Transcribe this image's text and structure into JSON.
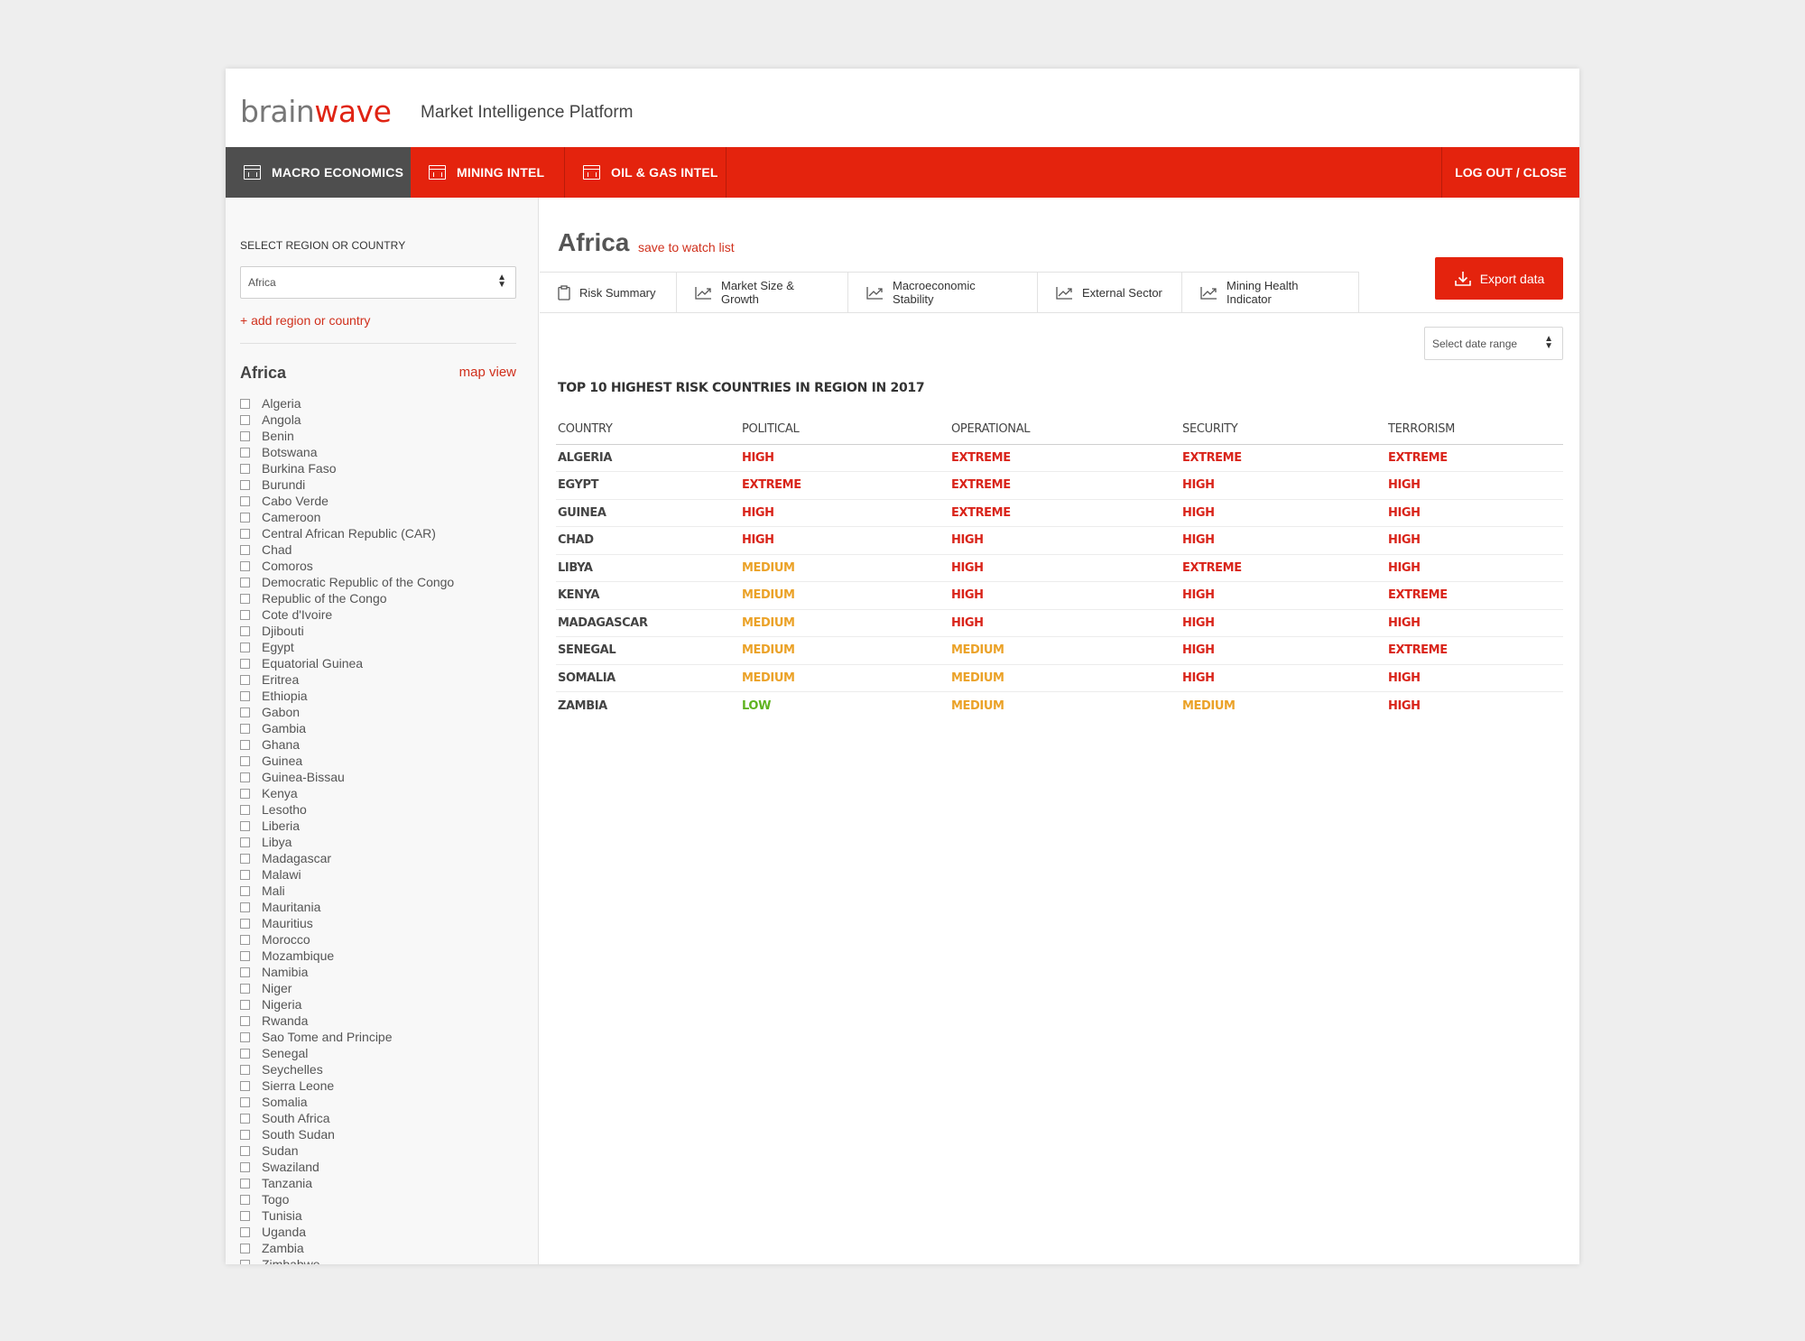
{
  "header": {
    "logo_part1": "brain",
    "logo_part2": "wave",
    "platform_title": "Market Intelligence Platform"
  },
  "nav": {
    "tabs": [
      {
        "label": "MACRO ECONOMICS",
        "icon": "chart-grid-icon",
        "active": true
      },
      {
        "label": "MINING INTEL",
        "icon": "calendar-grid-icon",
        "active": false
      },
      {
        "label": "OIL & GAS INTEL",
        "icon": "calendar-grid-icon",
        "active": false
      }
    ],
    "logout_label": "LOG OUT / CLOSE"
  },
  "sidebar": {
    "select_label": "SELECT REGION OR COUNTRY",
    "selected_region": "Africa",
    "add_link": "+ add region or country",
    "region_heading": "Africa",
    "map_view": "map view",
    "countries": [
      "Algeria",
      "Angola",
      "Benin",
      "Botswana",
      "Burkina Faso",
      "Burundi",
      "Cabo Verde",
      "Cameroon",
      "Central African Republic (CAR)",
      "Chad",
      "Comoros",
      "Democratic Republic of the Congo",
      "Republic of the Congo",
      "Cote d'Ivoire",
      "Djibouti",
      "Egypt",
      "Equatorial Guinea",
      "Eritrea",
      "Ethiopia",
      "Gabon",
      "Gambia",
      "Ghana",
      "Guinea",
      "Guinea-Bissau",
      "Kenya",
      "Lesotho",
      "Liberia",
      "Libya",
      "Madagascar",
      "Malawi",
      "Mali",
      "Mauritania",
      "Mauritius",
      "Morocco",
      "Mozambique",
      "Namibia",
      "Niger",
      "Nigeria",
      "Rwanda",
      "Sao Tome and Principe",
      "Senegal",
      "Seychelles",
      "Sierra Leone",
      "Somalia",
      "South Africa",
      "South Sudan",
      "Sudan",
      "Swaziland",
      "Tanzania",
      "Togo",
      "Tunisia",
      "Uganda",
      "Zambia",
      "Zimbabwe"
    ]
  },
  "main": {
    "heading": "Africa",
    "watch_link": "save to watch list",
    "export_label": "Export data",
    "tabs": [
      {
        "label": "Risk Summary",
        "icon": "clipboard-icon",
        "active": true
      },
      {
        "label": "Market Size & Growth",
        "icon": "trend-chart-icon",
        "active": false
      },
      {
        "label": "Macroeconomic Stability",
        "icon": "trend-chart-icon",
        "active": false
      },
      {
        "label": "External Sector",
        "icon": "trend-chart-icon",
        "active": false
      },
      {
        "label": "Mining Health Indicator",
        "icon": "trend-chart-icon",
        "active": false
      }
    ],
    "date_placeholder": "Select date range",
    "table_title": "TOP 10 HIGHEST RISK COUNTRIES IN REGION IN 2017",
    "columns": [
      "COUNTRY",
      "POLITICAL",
      "OPERATIONAL",
      "SECURITY",
      "TERRORISM"
    ],
    "rows": [
      [
        "ALGERIA",
        "HIGH",
        "EXTREME",
        "EXTREME",
        "EXTREME"
      ],
      [
        "EGYPT",
        "EXTREME",
        "EXTREME",
        "HIGH",
        "HIGH"
      ],
      [
        "GUINEA",
        "HIGH",
        "EXTREME",
        "HIGH",
        "HIGH"
      ],
      [
        "CHAD",
        "HIGH",
        "HIGH",
        "HIGH",
        "HIGH"
      ],
      [
        "LIBYA",
        "MEDIUM",
        "HIGH",
        "EXTREME",
        "HIGH"
      ],
      [
        "KENYA",
        "MEDIUM",
        "HIGH",
        "HIGH",
        "EXTREME"
      ],
      [
        "MADAGASCAR",
        "MEDIUM",
        "HIGH",
        "HIGH",
        "HIGH"
      ],
      [
        "SENEGAL",
        "MEDIUM",
        "MEDIUM",
        "HIGH",
        "EXTREME"
      ],
      [
        "SOMALIA",
        "MEDIUM",
        "MEDIUM",
        "HIGH",
        "HIGH"
      ],
      [
        "ZAMBIA",
        "LOW",
        "MEDIUM",
        "MEDIUM",
        "HIGH"
      ]
    ],
    "level_colors": {
      "EXTREME": "#d9241a",
      "HIGH": "#d9241a",
      "MEDIUM": "#eba228",
      "LOW": "#5fb31f"
    }
  },
  "colors": {
    "brand_red": "#e4230d",
    "nav_active": "#4e4e4e",
    "link_red": "#d0301c"
  }
}
